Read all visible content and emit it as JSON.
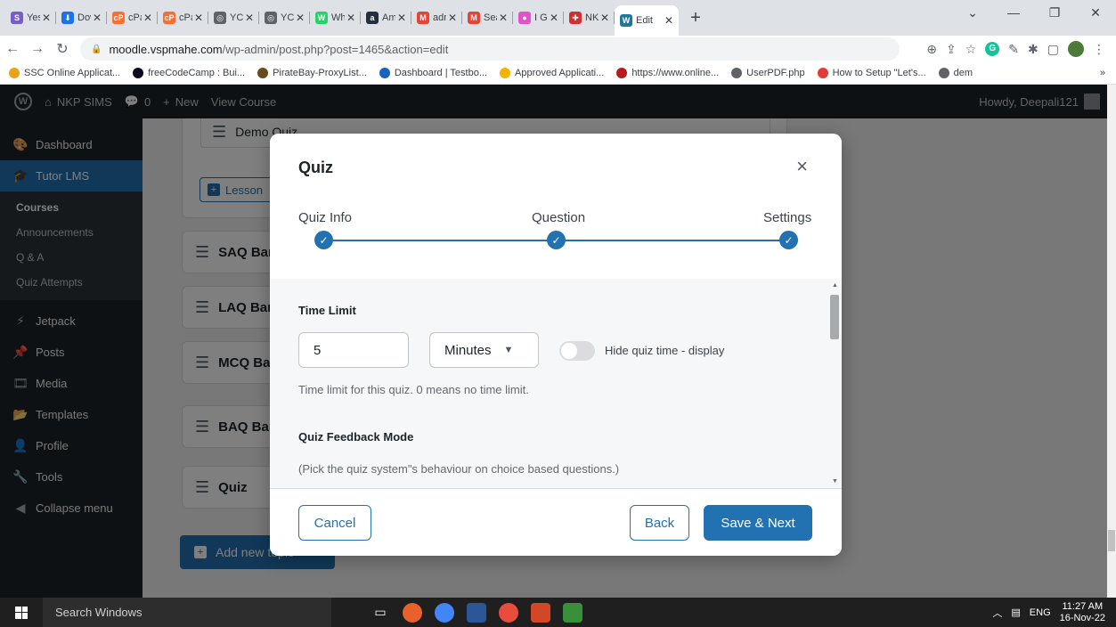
{
  "browser": {
    "tabs": [
      {
        "label": "Yes",
        "color": "#7a5cc8",
        "glyph": "S"
      },
      {
        "label": "Dov",
        "color": "#1a73e8",
        "glyph": "⬇"
      },
      {
        "label": "cPa",
        "color": "#ff6c2c",
        "glyph": "cP"
      },
      {
        "label": "cPa",
        "color": "#ff6c2c",
        "glyph": "cP"
      },
      {
        "label": "YCC",
        "color": "#5f6368",
        "glyph": "◎"
      },
      {
        "label": "YCC",
        "color": "#5f6368",
        "glyph": "◎"
      },
      {
        "label": "Wh",
        "color": "#25d366",
        "glyph": "W"
      },
      {
        "label": "Am",
        "color": "#232f3e",
        "glyph": "a"
      },
      {
        "label": "adn",
        "color": "#ea4335",
        "glyph": "M"
      },
      {
        "label": "Sea",
        "color": "#ea4335",
        "glyph": "M"
      },
      {
        "label": "I Ge",
        "color": "#e052c8",
        "glyph": "●"
      },
      {
        "label": "NKI",
        "color": "#d32f2f",
        "glyph": "✚"
      }
    ],
    "active_tab": {
      "label": "Edit",
      "color": "#21759b",
      "glyph": "W"
    },
    "new_tab_glyph": "+",
    "url_host": "moodle.vspmahe.com",
    "url_path": "/wp-admin/post.php?post=1465&action=edit",
    "bookmarks": [
      {
        "label": "SSC Online Applicat...",
        "color": "#e8a317"
      },
      {
        "label": "freeCodeCamp : Bui...",
        "color": "#0a0a23"
      },
      {
        "label": "PirateBay-ProxyList...",
        "color": "#6b4a1e"
      },
      {
        "label": "Dashboard | Testbo...",
        "color": "#1565c0"
      },
      {
        "label": "Approved Applicati...",
        "color": "#f4b400"
      },
      {
        "label": "https://www.online...",
        "color": "#b71c1c"
      },
      {
        "label": "UserPDF.php",
        "color": "#5f6368"
      },
      {
        "label": "How to Setup \"Let's...",
        "color": "#e53935"
      },
      {
        "label": "dem",
        "color": "#5f6368"
      }
    ],
    "bookmarks_more": "»"
  },
  "wp_bar": {
    "site": "NKP SIMS",
    "comments": "0",
    "new": "New",
    "view": "View Course",
    "howdy": "Howdy, Deepali121"
  },
  "sidebar": {
    "items": [
      {
        "label": "Dashboard",
        "icon": "🎨"
      },
      {
        "label": "Tutor LMS",
        "icon": "🎓"
      }
    ],
    "submenu": [
      "Courses",
      "Announcements",
      "Q & A",
      "Quiz Attempts"
    ],
    "items2": [
      {
        "label": "Jetpack",
        "icon": "⚡"
      },
      {
        "label": "Posts",
        "icon": "📌"
      },
      {
        "label": "Media",
        "icon": "🎞"
      },
      {
        "label": "Templates",
        "icon": "📂"
      },
      {
        "label": "Profile",
        "icon": "👤"
      },
      {
        "label": "Tools",
        "icon": "🔧"
      },
      {
        "label": "Collapse menu",
        "icon": "◀"
      }
    ]
  },
  "content": {
    "demo_quiz": "Demo Quiz",
    "lesson_btn": "Lesson",
    "topics": [
      "SAQ Bank",
      "LAQ Bank",
      "MCQ Bank",
      "BAQ Bank",
      "Quiz"
    ],
    "add_topic": "Add new topic"
  },
  "modal": {
    "title": "Quiz",
    "close": "×",
    "steps": [
      "Quiz Info",
      "Question",
      "Settings"
    ],
    "check": "✓",
    "time_limit_label": "Time Limit",
    "time_value": "5",
    "unit": "Minutes",
    "hide_time_label": "Hide quiz time - display",
    "time_help": "Time limit for this quiz. 0 means no time limit.",
    "feedback_label": "Quiz Feedback Mode",
    "feedback_help": "(Pick the quiz system\"s behaviour on choice based questions.)",
    "cancel": "Cancel",
    "back": "Back",
    "save_next": "Save & Next"
  },
  "taskbar": {
    "search": "Search Windows",
    "lang": "ENG",
    "time": "11:27 AM",
    "date": "16-Nov-22"
  }
}
